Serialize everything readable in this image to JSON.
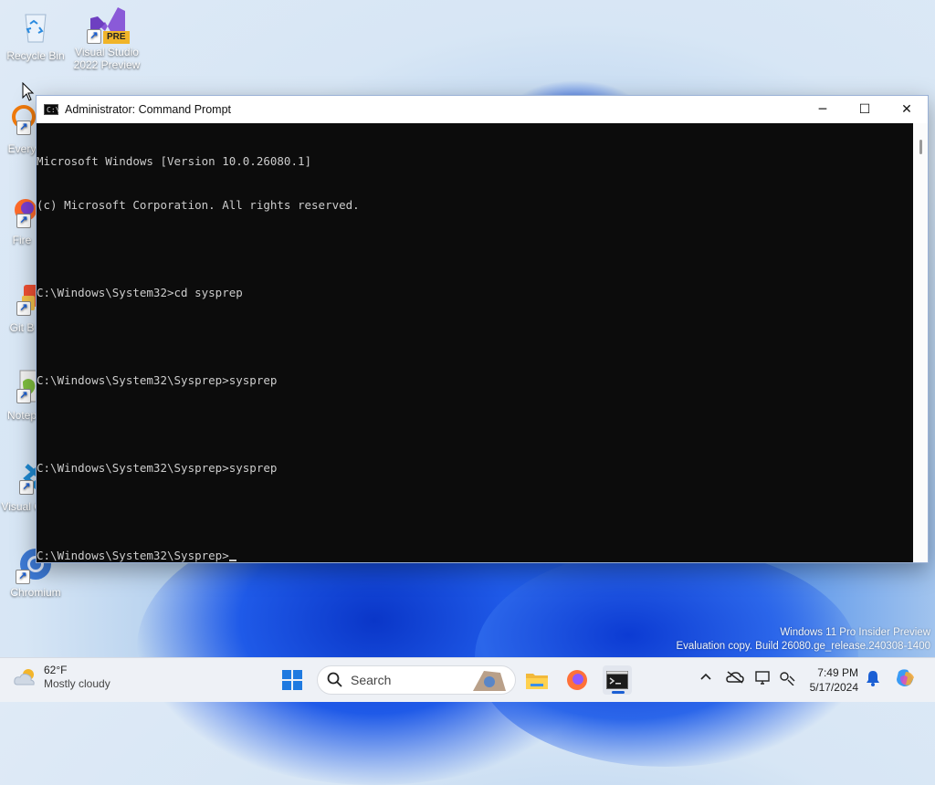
{
  "desktop": {
    "icons": [
      {
        "name": "recycle-bin",
        "label": "Recycle Bin"
      },
      {
        "name": "visual-studio-2022-preview",
        "label": "Visual Studio 2022 Preview",
        "badge": "PRE"
      },
      {
        "name": "everything",
        "label": "Every"
      },
      {
        "name": "firefox",
        "label": "Fire"
      },
      {
        "name": "git-bash",
        "label": "Git B"
      },
      {
        "name": "notepad-plus-plus",
        "label": "Notep"
      },
      {
        "name": "visual-studio-code",
        "label": "Visual Co"
      },
      {
        "name": "chromium",
        "label": "Chromium"
      }
    ],
    "watermark": {
      "line1": "Windows 11 Pro Insider Preview",
      "line2": "Evaluation copy. Build 26080.ge_release.240308-1400"
    }
  },
  "window": {
    "title": "Administrator: Command Prompt",
    "icon": "cmd-icon",
    "controls": {
      "minimize": "─",
      "maximize": "☐",
      "close": "✕"
    },
    "console_lines": [
      "Microsoft Windows [Version 10.0.26080.1]",
      "(c) Microsoft Corporation. All rights reserved.",
      "",
      "C:\\Windows\\System32>cd sysprep",
      "",
      "C:\\Windows\\System32\\Sysprep>sysprep",
      "",
      "C:\\Windows\\System32\\Sysprep>sysprep",
      "",
      "C:\\Windows\\System32\\Sysprep>"
    ]
  },
  "taskbar": {
    "weather": {
      "temp": "62°F",
      "desc": "Mostly cloudy"
    },
    "search_label": "Search",
    "apps": [
      "start-icon",
      "file-explorer-icon",
      "firefox-icon",
      "command-prompt-icon"
    ],
    "tray_icons": [
      "chevron-up-icon",
      "cloud-off-icon",
      "display-icon",
      "network-settings-icon"
    ],
    "clock": {
      "time": "7:49 PM",
      "date": "5/17/2024"
    },
    "accent": "#1a5fd4"
  }
}
